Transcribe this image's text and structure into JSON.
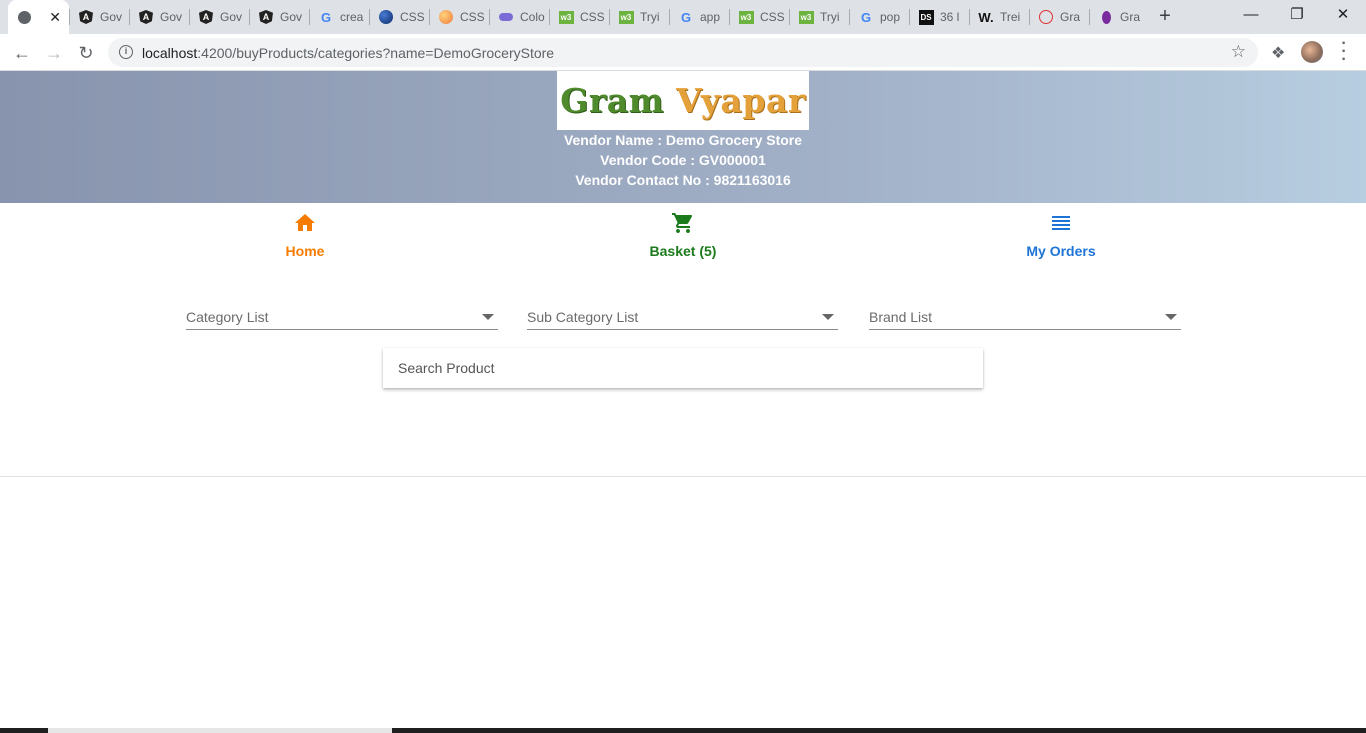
{
  "browser": {
    "tabs": [
      {
        "label": "",
        "icon": "globe-icon",
        "active": true
      },
      {
        "label": "Gov",
        "icon": "angular-icon"
      },
      {
        "label": "Gov",
        "icon": "angular-icon"
      },
      {
        "label": "Gov",
        "icon": "angular-icon"
      },
      {
        "label": "Gov",
        "icon": "angular-icon"
      },
      {
        "label": "crea",
        "icon": "google-icon"
      },
      {
        "label": "CSS",
        "icon": "blue-circle-icon"
      },
      {
        "label": "CSS",
        "icon": "orange-circle-icon"
      },
      {
        "label": "Colo",
        "icon": "purple-cloud-icon"
      },
      {
        "label": "CSS",
        "icon": "w3-icon"
      },
      {
        "label": "Tryi",
        "icon": "w3-icon"
      },
      {
        "label": "app",
        "icon": "google-icon"
      },
      {
        "label": "CSS",
        "icon": "w3-icon"
      },
      {
        "label": "Tryi",
        "icon": "w3-icon"
      },
      {
        "label": "pop",
        "icon": "google-icon"
      },
      {
        "label": "36 l",
        "icon": "ds-icon"
      },
      {
        "label": "Trei",
        "icon": "w-icon"
      },
      {
        "label": "Gra",
        "icon": "red-triangle-icon"
      },
      {
        "label": "Gra",
        "icon": "purple-drop-icon"
      }
    ],
    "url_host": "localhost",
    "url_rest": ":4200/buyProducts/categories?name=DemoGroceryStore"
  },
  "header": {
    "logo_gram": "Gram",
    "logo_vyapar": "Vyapar",
    "vendor_name": "Vendor Name : Demo Grocery Store",
    "vendor_code": "Vendor Code : GV000001",
    "vendor_contact": "Vendor Contact No : 9821163016"
  },
  "nav": {
    "home": "Home",
    "basket": "Basket (5)",
    "orders": "My Orders"
  },
  "colors": {
    "home": "#f57c00",
    "basket": "#1b7a1b",
    "orders": "#1e74d6"
  },
  "filters": {
    "category": "Category List",
    "subcategory": "Sub Category List",
    "brand": "Brand List"
  },
  "search": {
    "placeholder": "Search Product"
  }
}
